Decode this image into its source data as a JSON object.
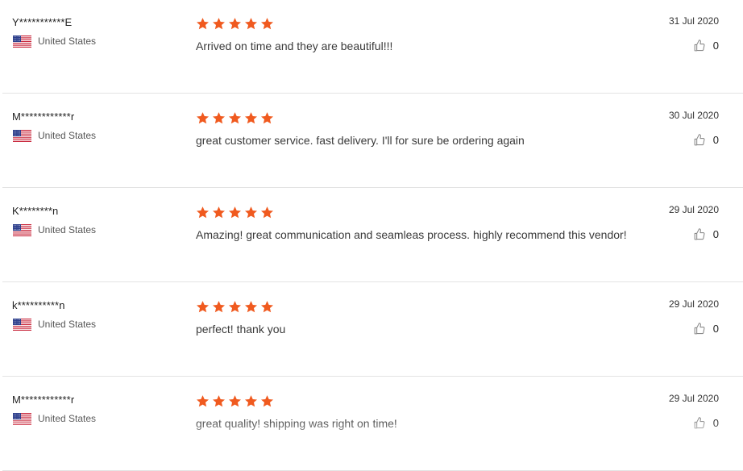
{
  "colors": {
    "star": "#f05a1f",
    "divider": "#e3e3e3",
    "text": "#3a3a3a"
  },
  "icons": {
    "flag": "us-flag-icon",
    "star": "star-icon",
    "like": "thumbs-up-icon"
  },
  "reviews": [
    {
      "name": "Y***********E",
      "country": "United States",
      "rating": 5,
      "text": "Arrived on time and they are beautiful!!!",
      "date": "31 Jul 2020",
      "likes": "0"
    },
    {
      "name": "M************r",
      "country": "United States",
      "rating": 5,
      "text": "great customer service. fast delivery. I'll for sure be ordering again",
      "date": "30 Jul 2020",
      "likes": "0"
    },
    {
      "name": "K********n",
      "country": "United States",
      "rating": 5,
      "text": "Amazing! great communication and seamleas process. highly recommend this vendor!",
      "date": "29 Jul 2020",
      "likes": "0"
    },
    {
      "name": "k**********n",
      "country": "United States",
      "rating": 5,
      "text": "perfect! thank you",
      "date": "29 Jul 2020",
      "likes": "0"
    },
    {
      "name": "M************r",
      "country": "United States",
      "rating": 5,
      "text": "great quality! shipping was right on time!",
      "date": "29 Jul 2020",
      "likes": "0"
    }
  ]
}
